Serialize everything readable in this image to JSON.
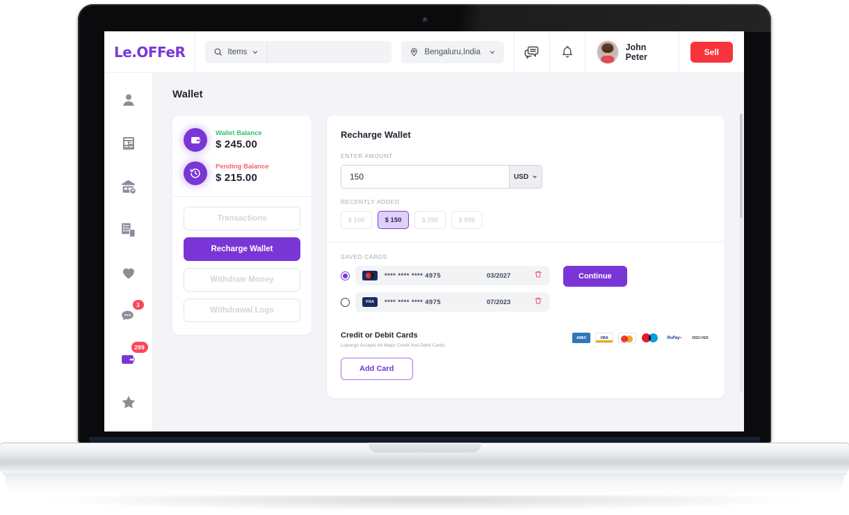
{
  "header": {
    "brand": "Le.OFFeR",
    "search": {
      "category": "Items",
      "value": "",
      "placeholder": ""
    },
    "location": "Bengaluru,India",
    "user_name": "John Peter",
    "sell_label": "Sell"
  },
  "sidebar": {
    "items": [
      {
        "name": "profile",
        "icon": "user-icon",
        "badge": ""
      },
      {
        "name": "listings",
        "icon": "newspaper-icon",
        "badge": ""
      },
      {
        "name": "store",
        "icon": "store-location-icon",
        "badge": ""
      },
      {
        "name": "orders",
        "icon": "order-bag-icon",
        "badge": ""
      },
      {
        "name": "favorites",
        "icon": "heart-icon",
        "badge": ""
      },
      {
        "name": "messages",
        "icon": "chat-icon",
        "badge": "3"
      },
      {
        "name": "wallet",
        "icon": "wallet-icon",
        "badge": "299"
      },
      {
        "name": "reviews",
        "icon": "star-icon",
        "badge": ""
      }
    ]
  },
  "page": {
    "title": "Wallet"
  },
  "wallet_card": {
    "wallet_balance_label": "Wallet Balance",
    "wallet_balance_value": "$ 245.00",
    "pending_balance_label": "Pending Balance",
    "pending_balance_value": "$ 215.00",
    "buttons": [
      {
        "label": "Transactions",
        "active": false
      },
      {
        "label": "Recharge Wallet",
        "active": true
      },
      {
        "label": "Withdraw Money",
        "active": false
      },
      {
        "label": "Withdrawal Logs",
        "active": false
      }
    ]
  },
  "recharge": {
    "title": "Recharge Wallet",
    "amount_label": "ENTER AMOUNT",
    "amount_value": "150",
    "currency": "USD",
    "recently_added_label": "RECENTLY ADDED",
    "chips": [
      {
        "label": "$ 100",
        "selected": false
      },
      {
        "label": "$ 150",
        "selected": true
      },
      {
        "label": "$ 250",
        "selected": false
      },
      {
        "label": "$ 500",
        "selected": false
      }
    ],
    "saved_cards_label": "SAVED CARDS",
    "cards": [
      {
        "brand": "mastercard",
        "brand_text": "",
        "number": "**** **** **** 4975",
        "expiry": "03/2027",
        "selected": true
      },
      {
        "brand": "visa",
        "brand_text": "VISA",
        "number": "**** **** **** 4975",
        "expiry": "07/2023",
        "selected": false
      }
    ],
    "continue_label": "Continue",
    "cdc_title": "Credit or Debit Cards",
    "cdc_sub": "Lopongo Accepts All Major Credit And Debit Cards.",
    "logos": [
      {
        "name": "amex",
        "text": "AMERICAN EXPRESS"
      },
      {
        "name": "visa",
        "text": "VISA"
      },
      {
        "name": "mastercard",
        "text": ""
      },
      {
        "name": "maestro",
        "text": ""
      },
      {
        "name": "rupay",
        "text": "RuPay"
      },
      {
        "name": "discover",
        "text": "DISCOVER"
      }
    ],
    "add_card_label": "Add Card"
  },
  "colors": {
    "purple": "#7a35d6",
    "red": "#f8333c",
    "green": "#2fc26b",
    "pending_red": "#f8636b",
    "page_bg": "#f4f4f8"
  }
}
